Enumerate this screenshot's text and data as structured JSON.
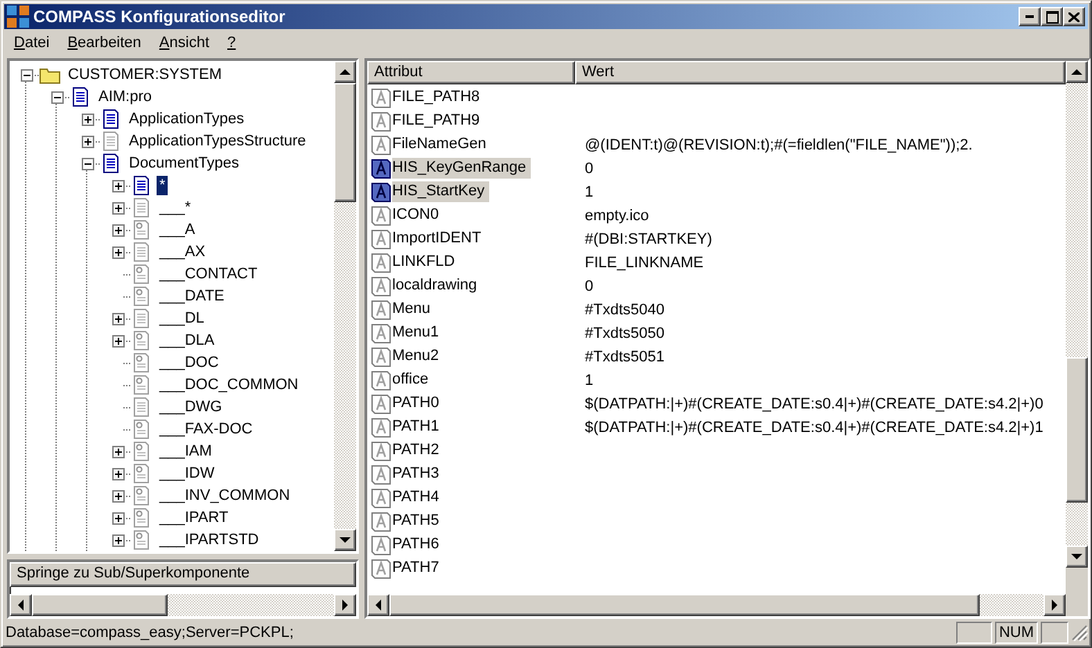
{
  "window": {
    "title": "COMPASS Konfigurationseditor"
  },
  "menu": [
    "Datei",
    "Bearbeiten",
    "Ansicht",
    "?"
  ],
  "tree": [
    {
      "label": "CUSTOMER:SYSTEM",
      "kind": "folder",
      "has_children": true,
      "expanded": true,
      "selected": false,
      "children": [
        {
          "label": "AIM:pro",
          "kind": "doc-blue",
          "has_children": true,
          "expanded": true,
          "selected": false,
          "children": [
            {
              "label": "ApplicationTypes",
              "kind": "doc-blue",
              "has_children": true,
              "expanded": false,
              "selected": false
            },
            {
              "label": "ApplicationTypesStructure",
              "kind": "doc-gray",
              "has_children": true,
              "expanded": false,
              "selected": false
            },
            {
              "label": "DocumentTypes",
              "kind": "doc-blue",
              "has_children": true,
              "expanded": true,
              "selected": false,
              "children": [
                {
                  "label": "*",
                  "kind": "doc-blue",
                  "has_children": true,
                  "expanded": false,
                  "selected": true
                },
                {
                  "label": "___*",
                  "kind": "doc-gray",
                  "has_children": true,
                  "expanded": false,
                  "selected": false
                },
                {
                  "label": "___A",
                  "kind": "attr-doc",
                  "has_children": true,
                  "expanded": false,
                  "selected": false
                },
                {
                  "label": "___AX",
                  "kind": "doc-gray",
                  "has_children": true,
                  "expanded": false,
                  "selected": false
                },
                {
                  "label": "___CONTACT",
                  "kind": "attr-doc",
                  "has_children": false,
                  "selected": false
                },
                {
                  "label": "___DATE",
                  "kind": "attr-doc",
                  "has_children": false,
                  "selected": false
                },
                {
                  "label": "___DL",
                  "kind": "doc-gray",
                  "has_children": true,
                  "expanded": false,
                  "selected": false
                },
                {
                  "label": "___DLA",
                  "kind": "attr-doc",
                  "has_children": true,
                  "expanded": false,
                  "selected": false
                },
                {
                  "label": "___DOC",
                  "kind": "attr-doc",
                  "has_children": false,
                  "selected": false
                },
                {
                  "label": "___DOC_COMMON",
                  "kind": "attr-doc",
                  "has_children": false,
                  "selected": false
                },
                {
                  "label": "___DWG",
                  "kind": "doc-gray",
                  "has_children": false,
                  "selected": false
                },
                {
                  "label": "___FAX-DOC",
                  "kind": "attr-doc",
                  "has_children": false,
                  "selected": false
                },
                {
                  "label": "___IAM",
                  "kind": "attr-doc",
                  "has_children": true,
                  "expanded": false,
                  "selected": false
                },
                {
                  "label": "___IDW",
                  "kind": "attr-doc",
                  "has_children": true,
                  "expanded": false,
                  "selected": false
                },
                {
                  "label": "___INV_COMMON",
                  "kind": "attr-doc",
                  "has_children": true,
                  "expanded": false,
                  "selected": false
                },
                {
                  "label": "___IPART",
                  "kind": "attr-doc",
                  "has_children": true,
                  "expanded": false,
                  "selected": false
                },
                {
                  "label": "___IPARTSTD",
                  "kind": "attr-doc",
                  "has_children": true,
                  "expanded": false,
                  "selected": false
                }
              ]
            }
          ]
        }
      ]
    }
  ],
  "jump_panel": {
    "title": "Springe zu Sub/Superkomponente"
  },
  "table": {
    "columns": [
      "Attribut",
      "Wert"
    ],
    "rows": [
      {
        "name": "FILE_PATH8",
        "selected": false
      },
      {
        "name": "FILE_PATH9",
        "selected": false
      },
      {
        "name": "FileNameGen",
        "value": "@(IDENT:t)@(REVISION:t);#(=fieldlen(\"FILE_NAME\"));2.",
        "selected": false
      },
      {
        "name": "HIS_KeyGenRange",
        "value": "0",
        "selected": true
      },
      {
        "name": "HIS_StartKey",
        "value": "1",
        "selected": true
      },
      {
        "name": "ICON0",
        "value": "empty.ico",
        "selected": false
      },
      {
        "name": "ImportIDENT",
        "value": "#(DBI:STARTKEY)",
        "selected": false
      },
      {
        "name": "LINKFLD",
        "value": "FILE_LINKNAME",
        "selected": false
      },
      {
        "name": "localdrawing",
        "value": "0",
        "selected": false
      },
      {
        "name": "Menu",
        "value": "#Txdts5040",
        "selected": false
      },
      {
        "name": "Menu1",
        "value": "#Txdts5050",
        "selected": false
      },
      {
        "name": "Menu2",
        "value": "#Txdts5051",
        "selected": false
      },
      {
        "name": "office",
        "value": "1",
        "selected": false
      },
      {
        "name": "PATH0",
        "value": "$(DATPATH:|+)#(CREATE_DATE:s0.4|+)#(CREATE_DATE:s4.2|+)0",
        "selected": false
      },
      {
        "name": "PATH1",
        "value": "$(DATPATH:|+)#(CREATE_DATE:s0.4|+)#(CREATE_DATE:s4.2|+)1",
        "selected": false
      },
      {
        "name": "PATH2",
        "selected": false
      },
      {
        "name": "PATH3",
        "selected": false
      },
      {
        "name": "PATH4",
        "selected": false
      },
      {
        "name": "PATH5",
        "selected": false
      },
      {
        "name": "PATH6",
        "selected": false
      },
      {
        "name": "PATH7",
        "selected": false
      }
    ]
  },
  "status_bar": {
    "text": "Database=compass_easy;Server=PCKPL;",
    "indicator": "NUM"
  }
}
